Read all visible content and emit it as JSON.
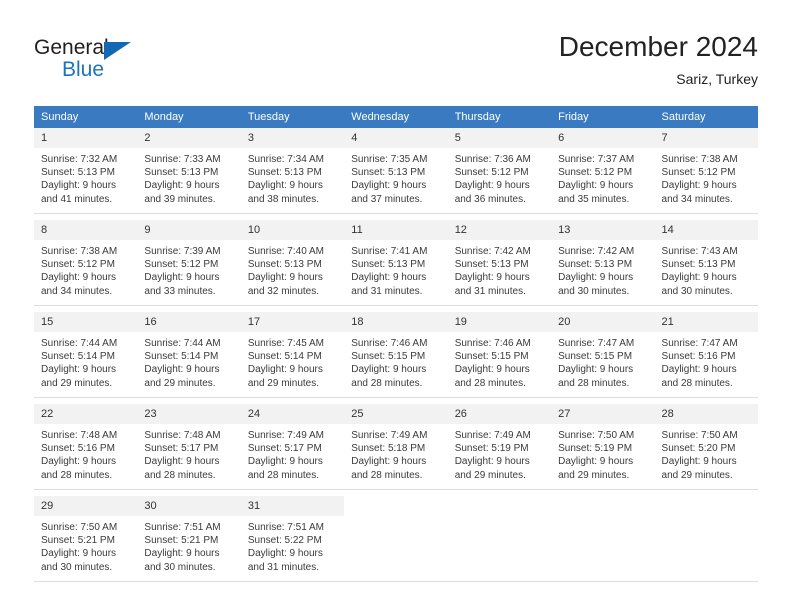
{
  "logo": {
    "word_top": "General",
    "word_bottom": "Blue",
    "triangle_color": "#1268b3",
    "blue_text_color": "#1b75bc"
  },
  "header": {
    "title": "December 2024",
    "subtitle": "Sariz, Turkey",
    "header_bg_color": "#3a7ac0",
    "daynum_bg_color": "#f2f2f2"
  },
  "weekday_headers": [
    "Sunday",
    "Monday",
    "Tuesday",
    "Wednesday",
    "Thursday",
    "Friday",
    "Saturday"
  ],
  "weeks": [
    {
      "days": [
        {
          "num": "1",
          "sunrise": "Sunrise: 7:32 AM",
          "sunset": "Sunset: 5:13 PM",
          "daylight1": "Daylight: 9 hours",
          "daylight2": "and 41 minutes."
        },
        {
          "num": "2",
          "sunrise": "Sunrise: 7:33 AM",
          "sunset": "Sunset: 5:13 PM",
          "daylight1": "Daylight: 9 hours",
          "daylight2": "and 39 minutes."
        },
        {
          "num": "3",
          "sunrise": "Sunrise: 7:34 AM",
          "sunset": "Sunset: 5:13 PM",
          "daylight1": "Daylight: 9 hours",
          "daylight2": "and 38 minutes."
        },
        {
          "num": "4",
          "sunrise": "Sunrise: 7:35 AM",
          "sunset": "Sunset: 5:13 PM",
          "daylight1": "Daylight: 9 hours",
          "daylight2": "and 37 minutes."
        },
        {
          "num": "5",
          "sunrise": "Sunrise: 7:36 AM",
          "sunset": "Sunset: 5:12 PM",
          "daylight1": "Daylight: 9 hours",
          "daylight2": "and 36 minutes."
        },
        {
          "num": "6",
          "sunrise": "Sunrise: 7:37 AM",
          "sunset": "Sunset: 5:12 PM",
          "daylight1": "Daylight: 9 hours",
          "daylight2": "and 35 minutes."
        },
        {
          "num": "7",
          "sunrise": "Sunrise: 7:38 AM",
          "sunset": "Sunset: 5:12 PM",
          "daylight1": "Daylight: 9 hours",
          "daylight2": "and 34 minutes."
        }
      ]
    },
    {
      "days": [
        {
          "num": "8",
          "sunrise": "Sunrise: 7:38 AM",
          "sunset": "Sunset: 5:12 PM",
          "daylight1": "Daylight: 9 hours",
          "daylight2": "and 34 minutes."
        },
        {
          "num": "9",
          "sunrise": "Sunrise: 7:39 AM",
          "sunset": "Sunset: 5:12 PM",
          "daylight1": "Daylight: 9 hours",
          "daylight2": "and 33 minutes."
        },
        {
          "num": "10",
          "sunrise": "Sunrise: 7:40 AM",
          "sunset": "Sunset: 5:13 PM",
          "daylight1": "Daylight: 9 hours",
          "daylight2": "and 32 minutes."
        },
        {
          "num": "11",
          "sunrise": "Sunrise: 7:41 AM",
          "sunset": "Sunset: 5:13 PM",
          "daylight1": "Daylight: 9 hours",
          "daylight2": "and 31 minutes."
        },
        {
          "num": "12",
          "sunrise": "Sunrise: 7:42 AM",
          "sunset": "Sunset: 5:13 PM",
          "daylight1": "Daylight: 9 hours",
          "daylight2": "and 31 minutes."
        },
        {
          "num": "13",
          "sunrise": "Sunrise: 7:42 AM",
          "sunset": "Sunset: 5:13 PM",
          "daylight1": "Daylight: 9 hours",
          "daylight2": "and 30 minutes."
        },
        {
          "num": "14",
          "sunrise": "Sunrise: 7:43 AM",
          "sunset": "Sunset: 5:13 PM",
          "daylight1": "Daylight: 9 hours",
          "daylight2": "and 30 minutes."
        }
      ]
    },
    {
      "days": [
        {
          "num": "15",
          "sunrise": "Sunrise: 7:44 AM",
          "sunset": "Sunset: 5:14 PM",
          "daylight1": "Daylight: 9 hours",
          "daylight2": "and 29 minutes."
        },
        {
          "num": "16",
          "sunrise": "Sunrise: 7:44 AM",
          "sunset": "Sunset: 5:14 PM",
          "daylight1": "Daylight: 9 hours",
          "daylight2": "and 29 minutes."
        },
        {
          "num": "17",
          "sunrise": "Sunrise: 7:45 AM",
          "sunset": "Sunset: 5:14 PM",
          "daylight1": "Daylight: 9 hours",
          "daylight2": "and 29 minutes."
        },
        {
          "num": "18",
          "sunrise": "Sunrise: 7:46 AM",
          "sunset": "Sunset: 5:15 PM",
          "daylight1": "Daylight: 9 hours",
          "daylight2": "and 28 minutes."
        },
        {
          "num": "19",
          "sunrise": "Sunrise: 7:46 AM",
          "sunset": "Sunset: 5:15 PM",
          "daylight1": "Daylight: 9 hours",
          "daylight2": "and 28 minutes."
        },
        {
          "num": "20",
          "sunrise": "Sunrise: 7:47 AM",
          "sunset": "Sunset: 5:15 PM",
          "daylight1": "Daylight: 9 hours",
          "daylight2": "and 28 minutes."
        },
        {
          "num": "21",
          "sunrise": "Sunrise: 7:47 AM",
          "sunset": "Sunset: 5:16 PM",
          "daylight1": "Daylight: 9 hours",
          "daylight2": "and 28 minutes."
        }
      ]
    },
    {
      "days": [
        {
          "num": "22",
          "sunrise": "Sunrise: 7:48 AM",
          "sunset": "Sunset: 5:16 PM",
          "daylight1": "Daylight: 9 hours",
          "daylight2": "and 28 minutes."
        },
        {
          "num": "23",
          "sunrise": "Sunrise: 7:48 AM",
          "sunset": "Sunset: 5:17 PM",
          "daylight1": "Daylight: 9 hours",
          "daylight2": "and 28 minutes."
        },
        {
          "num": "24",
          "sunrise": "Sunrise: 7:49 AM",
          "sunset": "Sunset: 5:17 PM",
          "daylight1": "Daylight: 9 hours",
          "daylight2": "and 28 minutes."
        },
        {
          "num": "25",
          "sunrise": "Sunrise: 7:49 AM",
          "sunset": "Sunset: 5:18 PM",
          "daylight1": "Daylight: 9 hours",
          "daylight2": "and 28 minutes."
        },
        {
          "num": "26",
          "sunrise": "Sunrise: 7:49 AM",
          "sunset": "Sunset: 5:19 PM",
          "daylight1": "Daylight: 9 hours",
          "daylight2": "and 29 minutes."
        },
        {
          "num": "27",
          "sunrise": "Sunrise: 7:50 AM",
          "sunset": "Sunset: 5:19 PM",
          "daylight1": "Daylight: 9 hours",
          "daylight2": "and 29 minutes."
        },
        {
          "num": "28",
          "sunrise": "Sunrise: 7:50 AM",
          "sunset": "Sunset: 5:20 PM",
          "daylight1": "Daylight: 9 hours",
          "daylight2": "and 29 minutes."
        }
      ]
    },
    {
      "days": [
        {
          "num": "29",
          "sunrise": "Sunrise: 7:50 AM",
          "sunset": "Sunset: 5:21 PM",
          "daylight1": "Daylight: 9 hours",
          "daylight2": "and 30 minutes."
        },
        {
          "num": "30",
          "sunrise": "Sunrise: 7:51 AM",
          "sunset": "Sunset: 5:21 PM",
          "daylight1": "Daylight: 9 hours",
          "daylight2": "and 30 minutes."
        },
        {
          "num": "31",
          "sunrise": "Sunrise: 7:51 AM",
          "sunset": "Sunset: 5:22 PM",
          "daylight1": "Daylight: 9 hours",
          "daylight2": "and 31 minutes."
        },
        {
          "num": "",
          "sunrise": "",
          "sunset": "",
          "daylight1": "",
          "daylight2": ""
        },
        {
          "num": "",
          "sunrise": "",
          "sunset": "",
          "daylight1": "",
          "daylight2": ""
        },
        {
          "num": "",
          "sunrise": "",
          "sunset": "",
          "daylight1": "",
          "daylight2": ""
        },
        {
          "num": "",
          "sunrise": "",
          "sunset": "",
          "daylight1": "",
          "daylight2": ""
        }
      ]
    }
  ]
}
